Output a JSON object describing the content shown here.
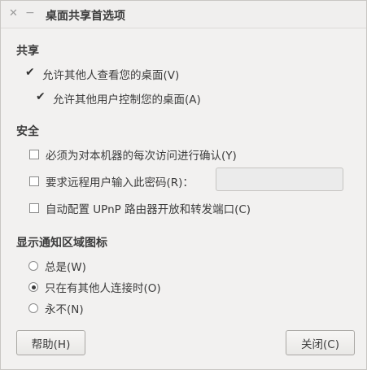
{
  "window": {
    "title": "桌面共享首选项",
    "close_glyph": "✕",
    "minimize_glyph": "−"
  },
  "sharing": {
    "heading": "共享",
    "allow_view": {
      "label": "允许其他人查看您的桌面(V)",
      "checked": true
    },
    "allow_control": {
      "label": "允许其他用户控制您的桌面(A)",
      "checked": true
    }
  },
  "security": {
    "heading": "安全",
    "confirm_each": {
      "label": "必须为对本机器的每次访问进行确认(Y)",
      "checked": false
    },
    "require_password": {
      "label": "要求远程用户输入此密码(R)：",
      "checked": false,
      "value": ""
    },
    "upnp": {
      "label": "自动配置 UPnP 路由器开放和转发端口(C)",
      "checked": false
    }
  },
  "notification": {
    "heading": "显示通知区域图标",
    "options": [
      {
        "label": "总是(W)",
        "selected": false
      },
      {
        "label": "只在有其他人连接时(O)",
        "selected": true
      },
      {
        "label": "永不(N)",
        "selected": false
      }
    ]
  },
  "buttons": {
    "help": "帮助(H)",
    "close": "关闭(C)"
  }
}
